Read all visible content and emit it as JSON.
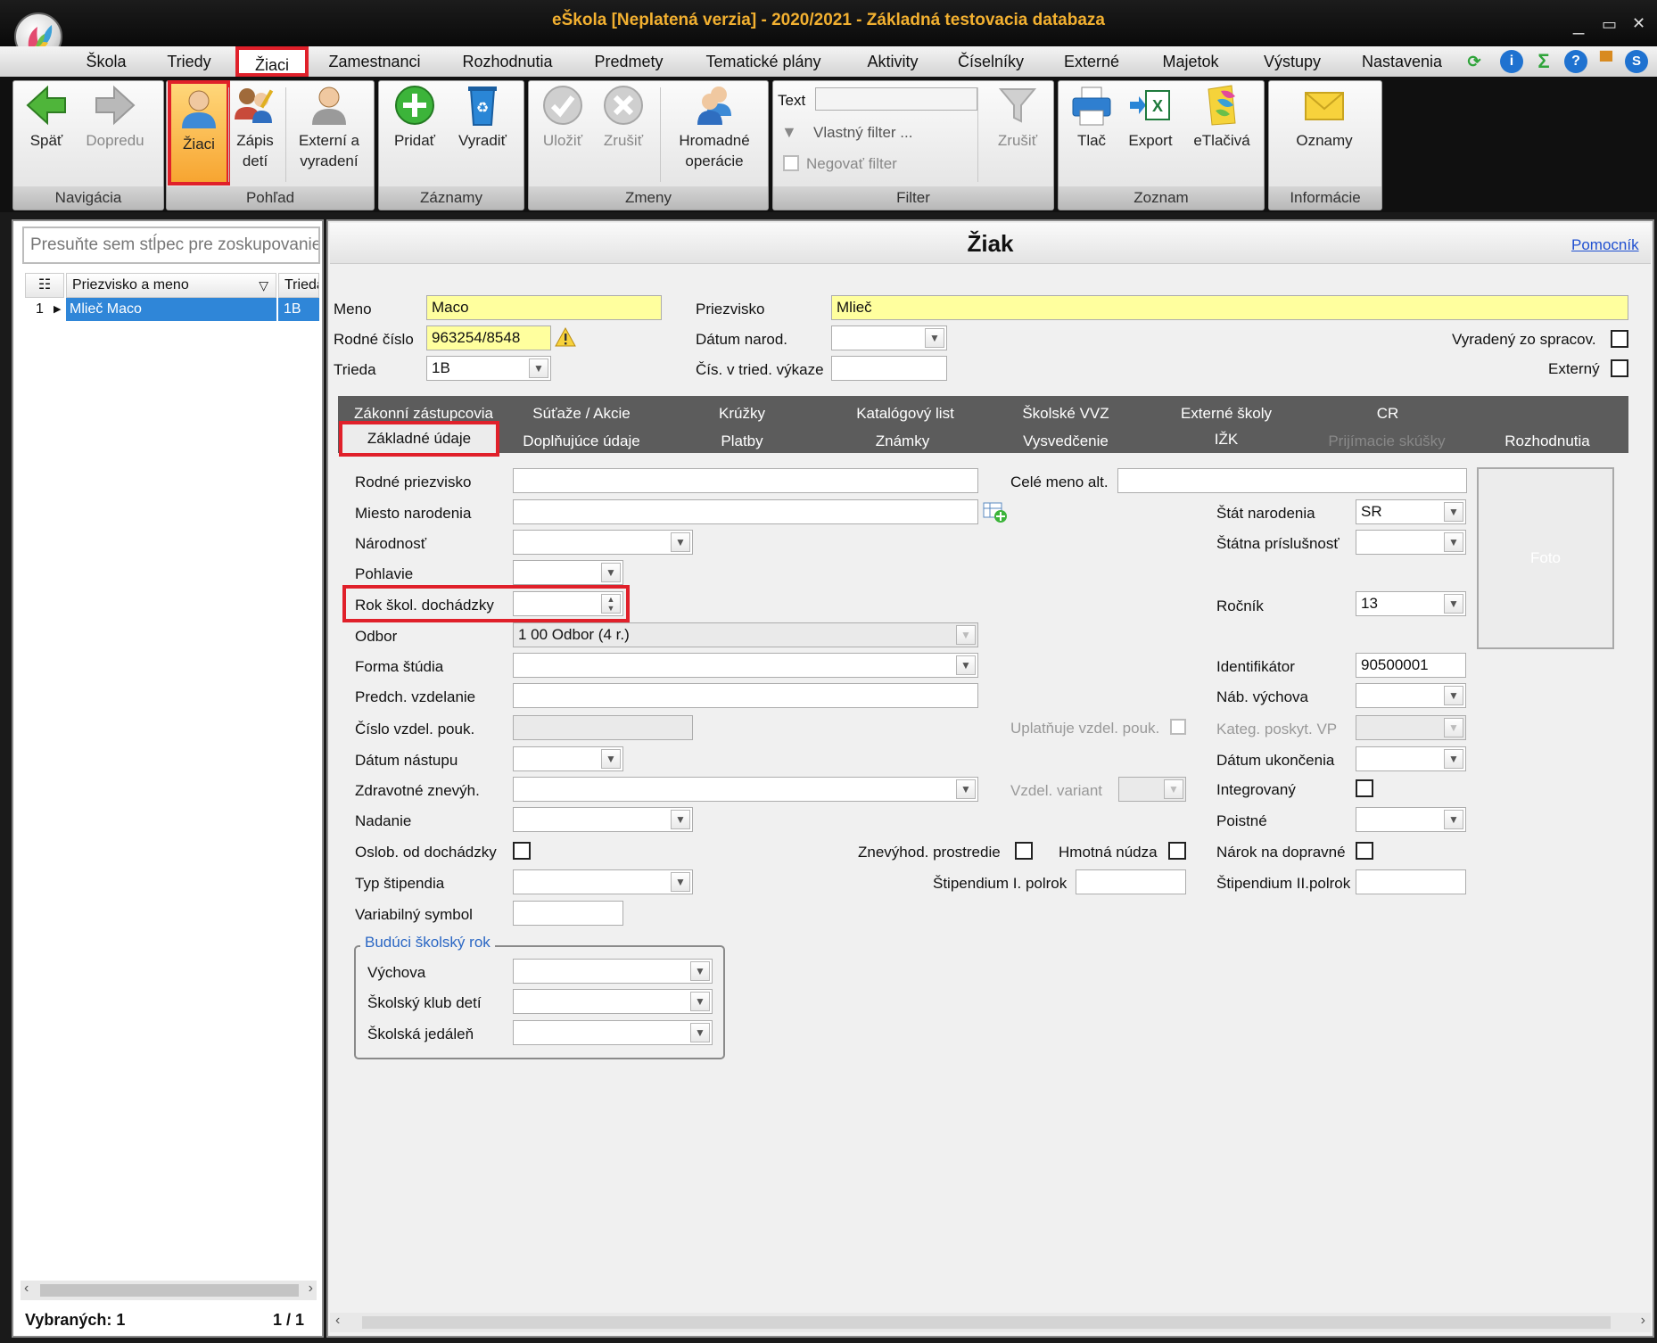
{
  "window": {
    "title": "eŠkola [Neplatená verzia] - 2020/2021 - Základná testovacia databaza",
    "controls": [
      "_",
      "▭",
      "✕"
    ]
  },
  "menu": {
    "items": [
      "Škola",
      "Triedy",
      "Žiaci",
      "Zamestnanci",
      "Rozhodnutia",
      "Predmety",
      "Tematické plány",
      "Aktivity",
      "Číselníky",
      "Externé",
      "Majetok",
      "Výstupy",
      "Nastavenia"
    ],
    "active": "Žiaci"
  },
  "ribbon": {
    "groups": {
      "navigacia": "Navigácia",
      "pohlad": "Pohľad",
      "zaznamy": "Záznamy",
      "zmeny": "Zmeny",
      "filter": "Filter",
      "zoznam": "Zoznam",
      "informacie": "Informácie"
    },
    "buttons": {
      "spat": "Späť",
      "dopredu": "Dopredu",
      "ziaci": "Žiaci",
      "zapis_1": "Zápis",
      "zapis_2": "detí",
      "externi_1": "Externí a",
      "externi_2": "vyradení",
      "pridat": "Pridať",
      "vyradit": "Vyradiť",
      "ulozit": "Uložiť",
      "zrusit": "Zrušiť",
      "hromadne_1": "Hromadné",
      "hromadne_2": "operácie",
      "filter_zrusit": "Zrušiť",
      "tlac": "Tlač",
      "export": "Export",
      "etlaciva": "eTlačivá",
      "oznamy": "Oznamy"
    },
    "filter": {
      "text_label": "Text",
      "text_value": "",
      "vlastny": "Vlastný filter ...",
      "negovat": "Negovať filter"
    }
  },
  "left": {
    "group_hint": "Presuňte sem stĺpec pre zoskupovanie",
    "columns": {
      "name": "Priezvisko a meno",
      "class": "Trieda"
    },
    "rows": [
      {
        "num": "1",
        "name": "Mlieč Maco",
        "class": "1B"
      }
    ],
    "status": {
      "selected": "Vybraných: 1",
      "page": "1 / 1"
    }
  },
  "form": {
    "title": "Žiak",
    "help_link": "Pomocník",
    "top": {
      "meno_label": "Meno",
      "meno": "Maco",
      "priezvisko_label": "Priezvisko",
      "priezvisko": "Mlieč",
      "rodne_cislo_label": "Rodné číslo",
      "rodne_cislo": "963254/8548",
      "datum_narod_label": "Dátum narod.",
      "datum_narod": "",
      "vyradeny_label": "Vyradený zo spracov.",
      "trieda_label": "Trieda",
      "trieda": "1B",
      "cis_tried_label": "Čís. v tried. výkaze",
      "cis_tried": "",
      "externy_label": "Externý"
    },
    "tabs_row1": [
      "Zákonní zástupcovia",
      "Súťaže / Akcie",
      "Krúžky",
      "Katalógový list",
      "Školské VVZ",
      "Externé školy",
      "CR"
    ],
    "tabs_row2": [
      "Základné údaje",
      "Doplňujúce údaje",
      "Platby",
      "Známky",
      "Vysvedčenie",
      "IŽK",
      "Prijímacie skúšky",
      "Rozhodnutia"
    ],
    "active_tab": "Základné údaje",
    "fields": {
      "rodne_priezvisko": "Rodné priezvisko",
      "cele_meno_alt": "Celé meno alt.",
      "miesto_narodenia": "Miesto narodenia",
      "stat_narodenia": "Štát narodenia",
      "stat_narodenia_val": "SR",
      "narodnost": "Národnosť",
      "statna_prislusnost": "Štátna príslušnosť",
      "pohlavie": "Pohlavie",
      "rok_skol": "Rok škol. dochádzky",
      "rocnik": "Ročník",
      "rocnik_val": "13",
      "odbor": "Odbor",
      "odbor_val": "1 00 Odbor (4 r.)",
      "forma_studia": "Forma štúdia",
      "identifikator": "Identifikátor",
      "identifikator_val": "90500001",
      "predch_vzdelanie": "Predch. vzdelanie",
      "nab_vychova": "Náb. výchova",
      "cislo_vzdel_pouk": "Číslo vzdel. pouk.",
      "uplatnuje": "Uplatňuje vzdel. pouk.",
      "kateg_poskyt": "Kateg. poskyt. VP",
      "datum_nastupu": "Dátum nástupu",
      "datum_ukoncenia": "Dátum ukončenia",
      "zdravotne": "Zdravotné znevýh.",
      "vzdel_variant": "Vzdel. variant",
      "integrovany": "Integrovaný",
      "nadanie": "Nadanie",
      "poistne": "Poistné",
      "oslob": "Oslob. od dochádzky",
      "znevyhod": "Znevýhod. prostredie",
      "hmotna": "Hmotná núdza",
      "narok": "Nárok na dopravné",
      "typ_stipendia": "Typ štipendia",
      "stip_1": "Štipendium I. polrok",
      "stip_2": "Štipendium II.polrok",
      "variabilny": "Variabilný symbol",
      "foto": "Foto"
    },
    "future": {
      "legend": "Budúci školský rok",
      "vychova": "Výchova",
      "skd": "Školský klub detí",
      "jedalen": "Školská jedáleň"
    }
  },
  "colors": {
    "accent": "#e0202a",
    "selection": "#2f86d8",
    "required": "#ffff9e",
    "title": "#f2b030"
  }
}
